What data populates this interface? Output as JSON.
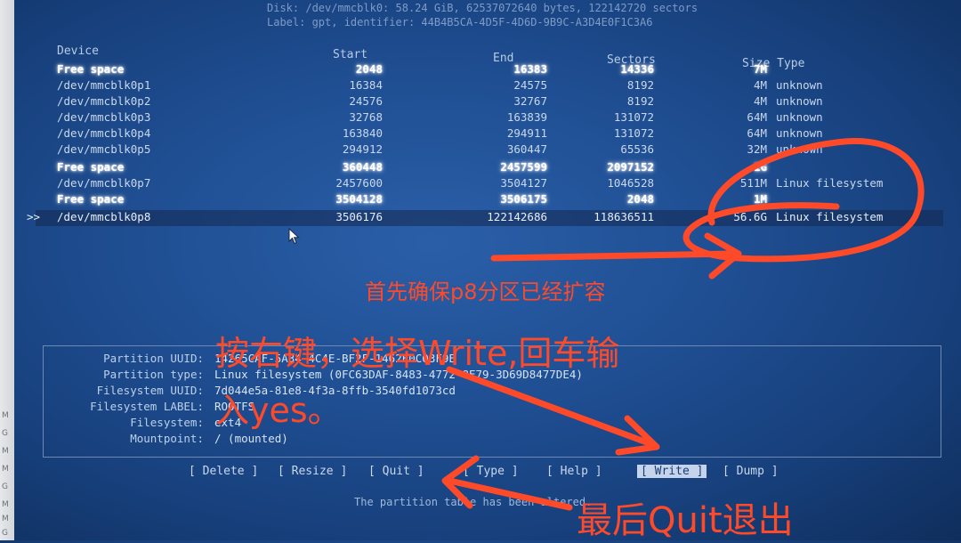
{
  "header": {
    "line1": "Disk: /dev/mmcblk0: 58.24 GiB, 62537072640 bytes, 122142720 sectors",
    "line2": "Label: gpt, identifier: 44B4B5CA-4D5F-4D6D-9B9C-A3D4E0F1C3A6"
  },
  "table": {
    "headers": {
      "device": "Device",
      "start": "Start",
      "end": "End",
      "sectors": "Sectors",
      "size_type": "Size Type"
    },
    "rows": [
      {
        "device": "Free space",
        "start": "2048",
        "end": "16383",
        "sectors": "14336",
        "size": "7M",
        "type": "",
        "free": true
      },
      {
        "device": "/dev/mmcblk0p1",
        "start": "16384",
        "end": "24575",
        "sectors": "8192",
        "size": "4M",
        "type": "unknown"
      },
      {
        "device": "/dev/mmcblk0p2",
        "start": "24576",
        "end": "32767",
        "sectors": "8192",
        "size": "4M",
        "type": "unknown"
      },
      {
        "device": "/dev/mmcblk0p3",
        "start": "32768",
        "end": "163839",
        "sectors": "131072",
        "size": "64M",
        "type": "unknown"
      },
      {
        "device": "/dev/mmcblk0p4",
        "start": "163840",
        "end": "294911",
        "sectors": "131072",
        "size": "64M",
        "type": "unknown"
      },
      {
        "device": "/dev/mmcblk0p5",
        "start": "294912",
        "end": "360447",
        "sectors": "65536",
        "size": "32M",
        "type": "unknown"
      },
      {
        "device": "Free space",
        "start": "360448",
        "end": "2457599",
        "sectors": "2097152",
        "size": "1G",
        "type": "",
        "free": true
      },
      {
        "device": "/dev/mmcblk0p7",
        "start": "2457600",
        "end": "3504127",
        "sectors": "1046528",
        "size": "511M",
        "type": "Linux filesystem"
      },
      {
        "device": "Free space",
        "start": "3504128",
        "end": "3506175",
        "sectors": "2048",
        "size": "1M",
        "type": "",
        "free": true
      },
      {
        "device": "/dev/mmcblk0p8",
        "start": "3506176",
        "end": "122142686",
        "sectors": "118636511",
        "size": "56.6G",
        "type": "Linux filesystem",
        "selected": true,
        "marker": ">>"
      }
    ]
  },
  "details": [
    {
      "label": "Partition UUID:",
      "value": "14265CAF-5A34-4C4E-BF2F-1462E0C03F9E"
    },
    {
      "label": "Partition type:",
      "value": "Linux filesystem (0FC63DAF-8483-4772-8E79-3D69D8477DE4)"
    },
    {
      "label": "Filesystem UUID:",
      "value": "7d044e5a-81e8-4f3a-8ffb-3540fd1073cd"
    },
    {
      "label": "Filesystem LABEL:",
      "value": "ROOTFS"
    },
    {
      "label": "Filesystem:",
      "value": "ext4"
    },
    {
      "label": "Mountpoint:",
      "value": "/ (mounted)"
    }
  ],
  "menu": [
    {
      "label": "[ Delete ]"
    },
    {
      "label": "[ Resize ]"
    },
    {
      "label": "[  Quit  ]"
    },
    {
      "label": "[  Type  ]"
    },
    {
      "label": "[  Help  ]"
    },
    {
      "label": "[ Write ]",
      "active": true
    },
    {
      "label": "[  Dump  ]"
    }
  ],
  "status": "The partition table has been altered.",
  "annotations": {
    "note1": "首先确保p8分区已经扩容",
    "note2a": "按右键，选择Write,回车输",
    "note2b": "入yes。",
    "note3": "最后Quit退出"
  },
  "colors": {
    "annotation": "#ff4a2a",
    "background": "#1f4e92"
  },
  "bezel_labels": [
    "M",
    "G",
    "M",
    "M",
    "G",
    "M",
    "M",
    "G"
  ]
}
